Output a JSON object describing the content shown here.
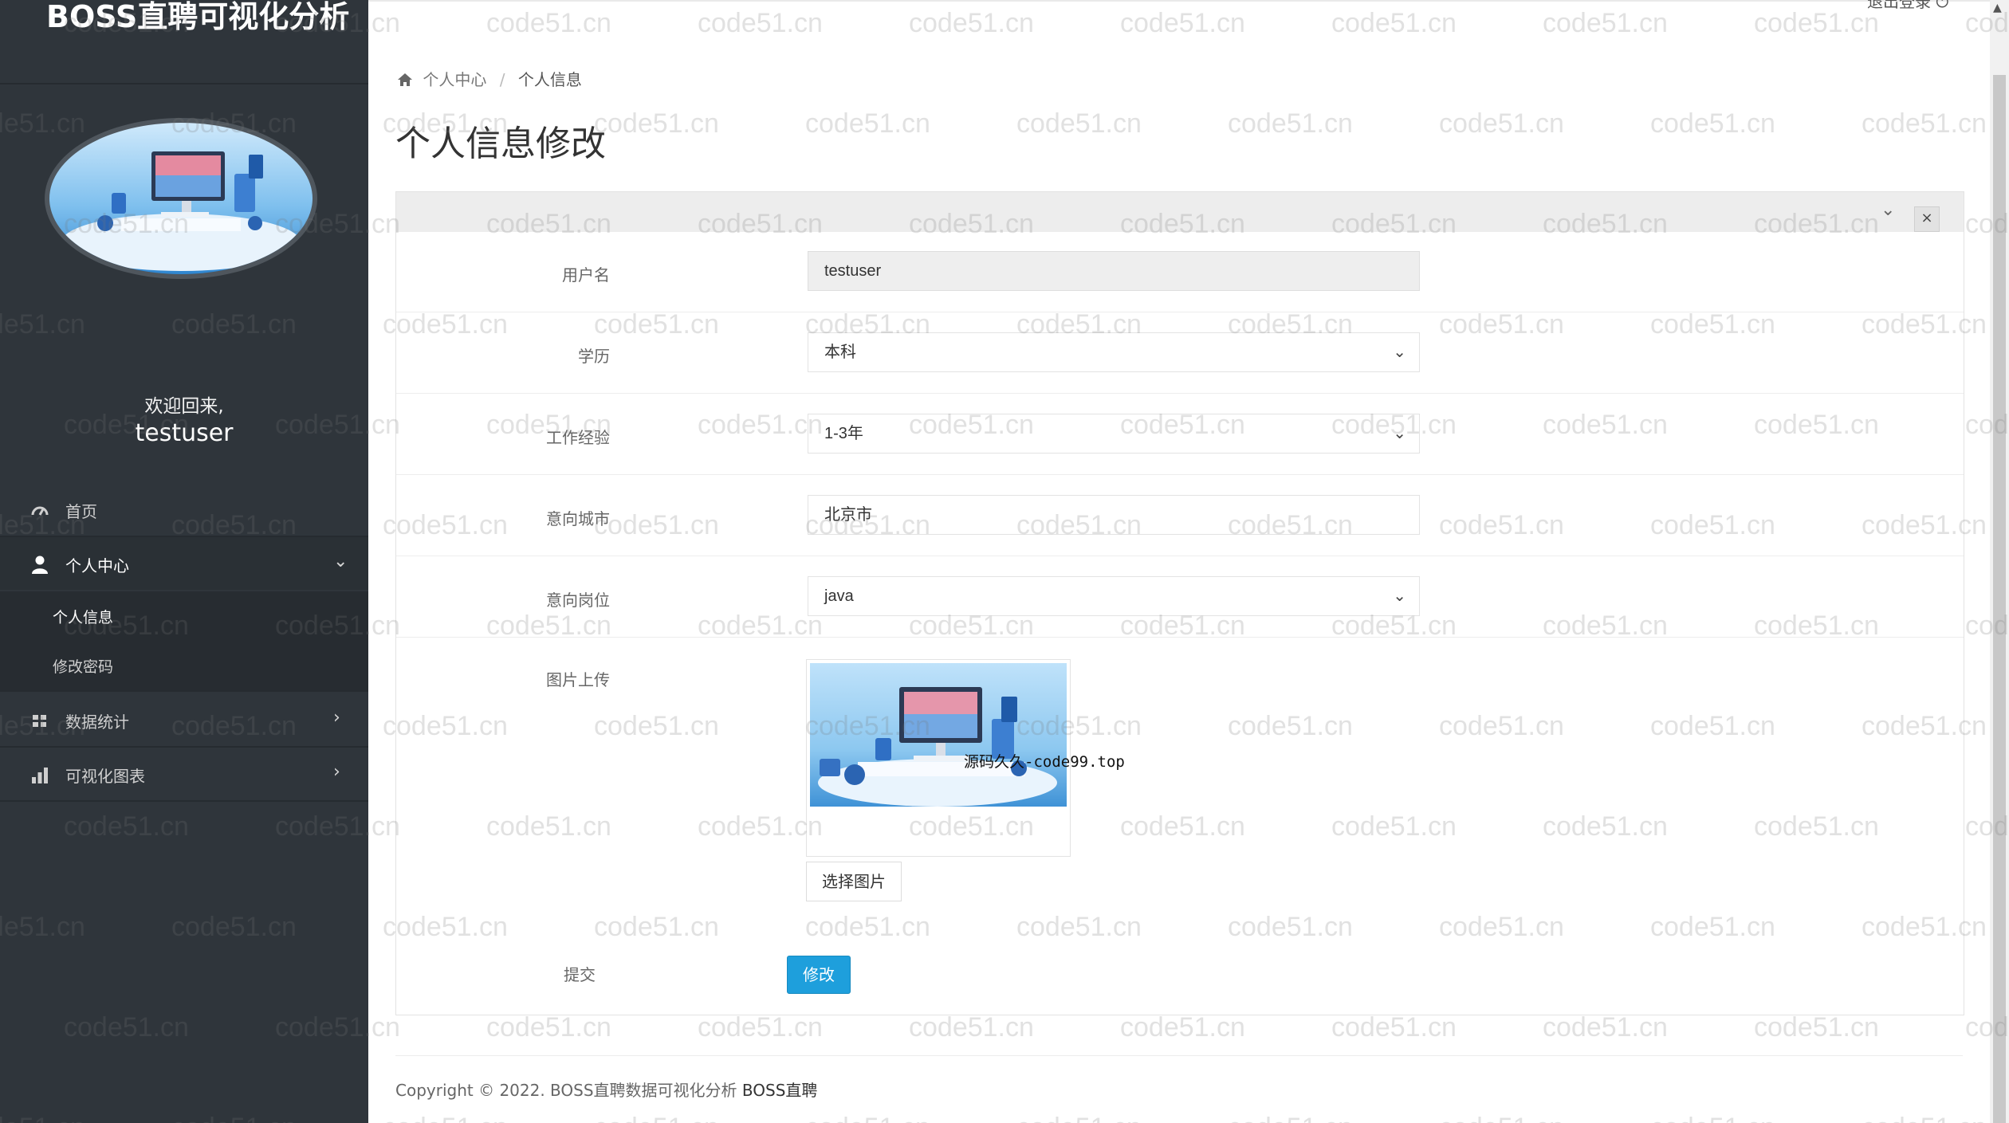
{
  "app": {
    "title": "BOSS直聘可视化分析",
    "logout_label": "退出登录"
  },
  "user": {
    "welcome": "欢迎回来,",
    "name": "testuser"
  },
  "sidebar": {
    "items": [
      {
        "label": "首页",
        "icon": "dashboard-gauge-icon"
      },
      {
        "label": "个人中心",
        "icon": "user-icon",
        "expanded": true,
        "children": [
          {
            "label": "个人信息",
            "current": true
          },
          {
            "label": "修改密码"
          }
        ]
      },
      {
        "label": "数据统计",
        "icon": "grid-icon"
      },
      {
        "label": "可视化图表",
        "icon": "bar-chart-icon"
      }
    ]
  },
  "breadcrumb": {
    "home": "个人中心",
    "current": "个人信息"
  },
  "page": {
    "title": "个人信息修改"
  },
  "form": {
    "username": {
      "label": "用户名",
      "value": "testuser"
    },
    "education": {
      "label": "学历",
      "value": "本科"
    },
    "experience": {
      "label": "工作经验",
      "value": "1-3年"
    },
    "city": {
      "label": "意向城市",
      "value": "北京市"
    },
    "position": {
      "label": "意向岗位",
      "value": "java"
    },
    "image": {
      "label": "图片上传",
      "choose_label": "选择图片"
    },
    "submit": {
      "label": "提交",
      "button": "修改"
    }
  },
  "overlay_text": "源码久久-code99.top",
  "footer": {
    "text": "Copyright © 2022. BOSS直聘数据可视化分析 ",
    "brand": "BOSS直聘"
  },
  "watermark": "code51.cn",
  "colors": {
    "sidebar": "#2f353b",
    "accent": "#1e9fdc"
  }
}
